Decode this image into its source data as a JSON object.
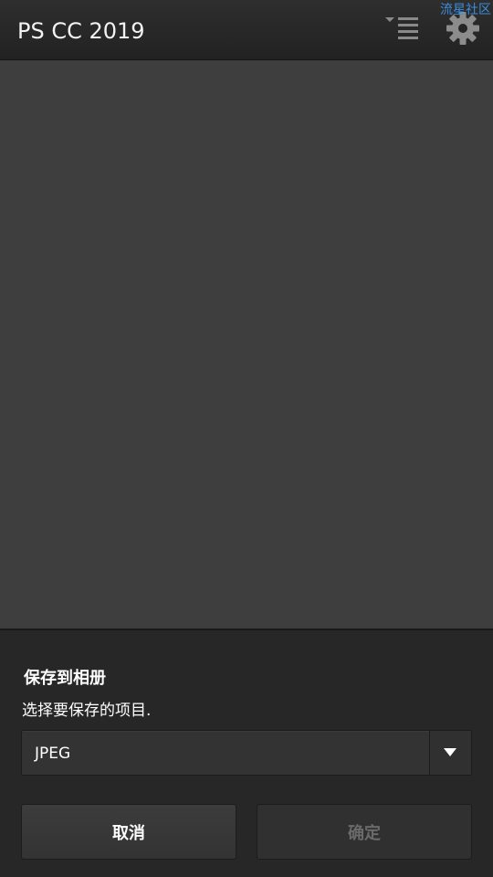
{
  "header": {
    "app_title": "PS CC 2019",
    "watermark": "流星社区"
  },
  "dialog": {
    "title": "保存到相册",
    "subtitle": "选择要保存的项目.",
    "format_select": {
      "value": "JPEG"
    },
    "cancel_label": "取消",
    "confirm_label": "确定"
  },
  "icons": {
    "menu": "list-menu-icon",
    "settings": "gear-icon",
    "dropdown": "chevron-down-icon"
  },
  "colors": {
    "background": "#3d3d3d",
    "titlebar": "#262626",
    "dialog": "#272727",
    "watermark": "#3b8ddd",
    "disabled_text": "#6a6a6a"
  }
}
